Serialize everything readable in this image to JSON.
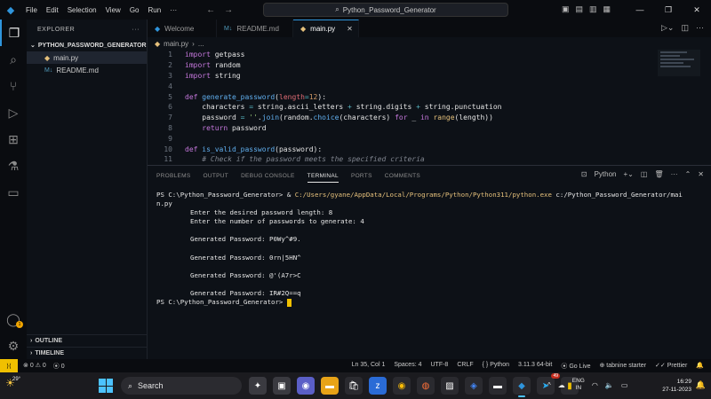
{
  "titlebar": {
    "menu": [
      "File",
      "Edit",
      "Selection",
      "View",
      "Go",
      "Run"
    ],
    "more": "···",
    "search_text": "Python_Password_Generator"
  },
  "explorer": {
    "title": "EXPLORER",
    "folder": "PYTHON_PASSWORD_GENERATOR",
    "files": [
      {
        "name": "main.py",
        "icon": "python-icon"
      },
      {
        "name": "README.md",
        "icon": "markdown-icon"
      }
    ],
    "outline": "OUTLINE",
    "timeline": "TIMELINE"
  },
  "tabs": [
    {
      "label": "Welcome",
      "icon": "vscode-icon"
    },
    {
      "label": "README.md",
      "icon": "markdown-icon"
    },
    {
      "label": "main.py",
      "icon": "python-icon",
      "active": true
    }
  ],
  "breadcrumb": {
    "file": "main.py",
    "rest": "..."
  },
  "editor": {
    "lines": [
      {
        "n": "1",
        "segs": [
          [
            "kw",
            "import"
          ],
          [
            "plain",
            " getpass"
          ]
        ]
      },
      {
        "n": "2",
        "segs": [
          [
            "kw",
            "import"
          ],
          [
            "plain",
            " random"
          ]
        ]
      },
      {
        "n": "3",
        "segs": [
          [
            "kw",
            "import"
          ],
          [
            "plain",
            " string"
          ]
        ]
      },
      {
        "n": "4",
        "segs": []
      },
      {
        "n": "5",
        "segs": [
          [
            "kw",
            "def"
          ],
          [
            "plain",
            " "
          ],
          [
            "fn",
            "generate_password"
          ],
          [
            "plain",
            "("
          ],
          [
            "var",
            "length"
          ],
          [
            "op",
            "="
          ],
          [
            "num",
            "12"
          ],
          [
            "plain",
            "):"
          ]
        ]
      },
      {
        "n": "6",
        "segs": [
          [
            "plain",
            "    characters "
          ],
          [
            "op",
            "="
          ],
          [
            "plain",
            " string.ascii_letters "
          ],
          [
            "op",
            "+"
          ],
          [
            "plain",
            " string.digits "
          ],
          [
            "op",
            "+"
          ],
          [
            "plain",
            " string.punctuation"
          ]
        ]
      },
      {
        "n": "7",
        "segs": [
          [
            "plain",
            "    password "
          ],
          [
            "op",
            "="
          ],
          [
            "plain",
            " "
          ],
          [
            "str",
            "''"
          ],
          [
            "plain",
            "."
          ],
          [
            "fn",
            "join"
          ],
          [
            "plain",
            "(random."
          ],
          [
            "fn",
            "choice"
          ],
          [
            "plain",
            "(characters) "
          ],
          [
            "kw",
            "for"
          ],
          [
            "plain",
            " _ "
          ],
          [
            "kw",
            "in"
          ],
          [
            "plain",
            " "
          ],
          [
            "kw2",
            "range"
          ],
          [
            "plain",
            "(length))"
          ]
        ]
      },
      {
        "n": "8",
        "segs": [
          [
            "kw",
            "    return"
          ],
          [
            "plain",
            " password"
          ]
        ]
      },
      {
        "n": "9",
        "segs": []
      },
      {
        "n": "10",
        "segs": [
          [
            "kw",
            "def"
          ],
          [
            "plain",
            " "
          ],
          [
            "fn",
            "is_valid_password"
          ],
          [
            "plain",
            "(password):"
          ]
        ]
      },
      {
        "n": "11",
        "segs": [
          [
            "cmt",
            "    # Check if the password meets the specified criteria"
          ]
        ]
      }
    ]
  },
  "panel": {
    "tabs": [
      "PROBLEMS",
      "OUTPUT",
      "DEBUG CONSOLE",
      "TERMINAL",
      "PORTS",
      "COMMENTS"
    ],
    "active_tab": "TERMINAL",
    "shell": "Python",
    "terminal": {
      "cmd_prompt": "PS C:\\Python_Password_Generator> & ",
      "cmd_path": "C:/Users/gyane/AppData/Local/Programs/Python/Python311/python.exe",
      "cmd_arg": " c:/Python_Password_Generator/mai",
      "cmd_wrap": "n.py",
      "lines": [
        "Enter the desired password length: 8",
        "Enter the number of passwords to generate: 4",
        "",
        "Generated Password: P0Wy^#9.",
        "",
        "Generated Password: 0rn|5HN^",
        "",
        "Generated Password: @'(A7r>C",
        "",
        "Generated Password: IR#2Q==q"
      ],
      "final_prompt": "PS C:\\Python_Password_Generator> "
    }
  },
  "statusbar": {
    "errors": "0",
    "warnings": "0",
    "ports": "0",
    "position": "Ln 35, Col 1",
    "spaces": "Spaces: 4",
    "encoding": "UTF-8",
    "eol": "CRLF",
    "language": "Python",
    "interpreter": "3.11.3 64-bit",
    "golive": "Go Live",
    "tabnine": "tabnine starter",
    "prettier": "Prettier"
  },
  "taskbar": {
    "temperature": "29°",
    "search": "Search",
    "badge": "49",
    "lang_top": "ENG",
    "lang_bottom": "IN",
    "time": "16:29",
    "date": "27-11-2023"
  },
  "colors": {
    "accent": "#2f95dc",
    "cursor": "#f0c000",
    "path": "#e5c07b"
  }
}
